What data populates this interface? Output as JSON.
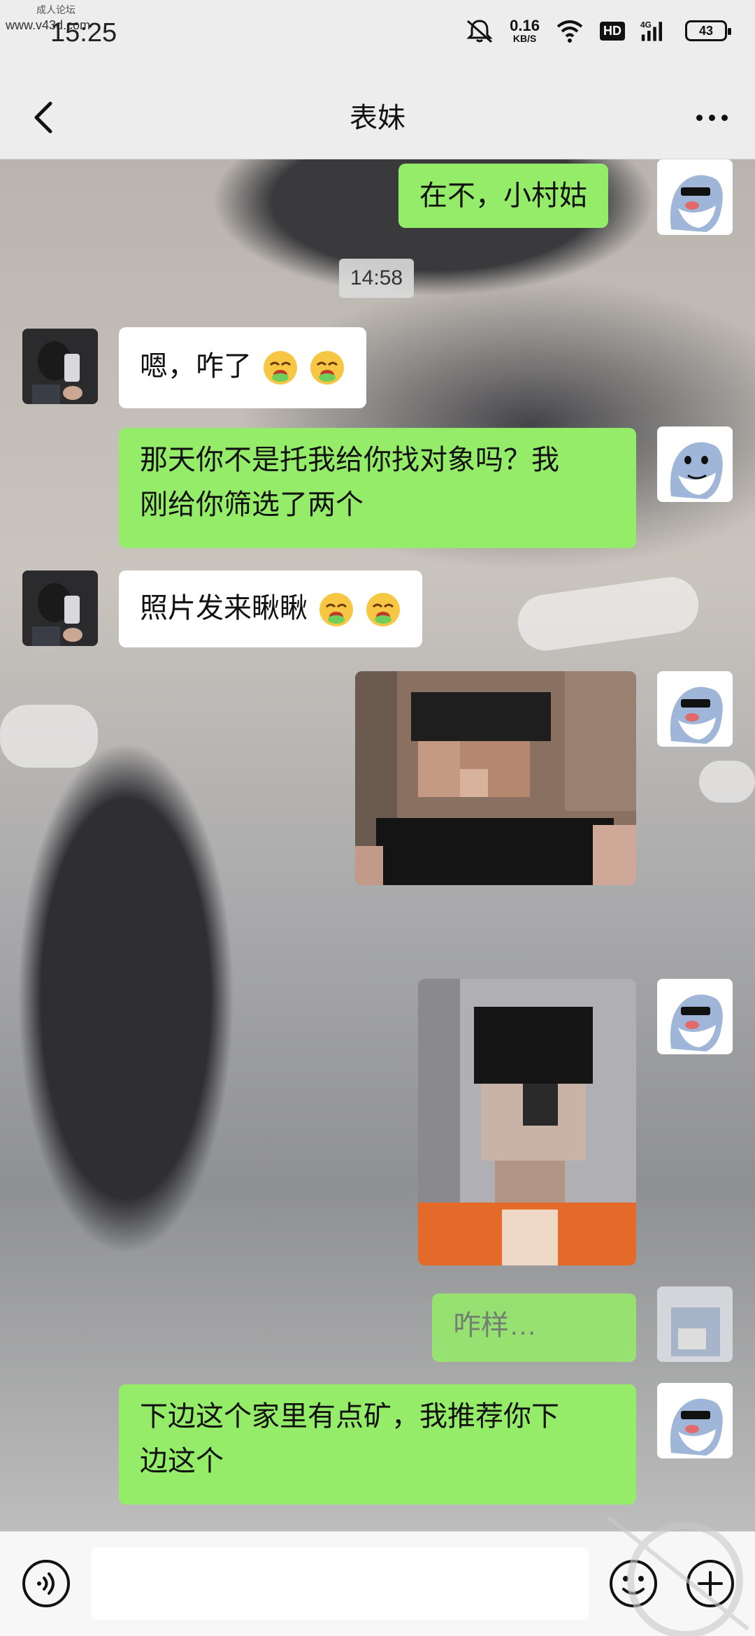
{
  "status_bar": {
    "watermark_text": "成人论坛",
    "watermark_site": "www.v43d.com",
    "time": "15:25",
    "net_speed_value": "0.16",
    "net_speed_unit": "KB/S",
    "hd_badge": "HD",
    "signal_label": "4G",
    "battery": "43"
  },
  "nav": {
    "title": "表妹"
  },
  "chat": {
    "timestamp": "14:58",
    "messages": [
      {
        "side": "self",
        "text": "在不，小村姑"
      },
      {
        "side": "other",
        "text": "嗯，咋了"
      },
      {
        "side": "self",
        "text_line1": "那天你不是托我给你找对象吗？我",
        "text_line2": "刚给你筛选了两个"
      },
      {
        "side": "other",
        "text": "照片发来瞅瞅"
      },
      {
        "side": "self",
        "type": "image"
      },
      {
        "side": "self",
        "type": "image"
      },
      {
        "side": "self",
        "text": "咋样…"
      },
      {
        "side": "self",
        "text_line1": "下边这个家里有点矿，我推荐你下",
        "text_line2": "边这个"
      }
    ]
  },
  "input_bar": {
    "placeholder": ""
  },
  "icons": {
    "back": "back-arrow-icon",
    "more": "more-dots-icon",
    "voice": "voice-icon",
    "emoji": "emoji-icon",
    "plus": "plus-icon"
  },
  "colors": {
    "self_bubble": "#95ec69",
    "other_bubble": "#ffffff",
    "bar_background": "#ededed"
  }
}
